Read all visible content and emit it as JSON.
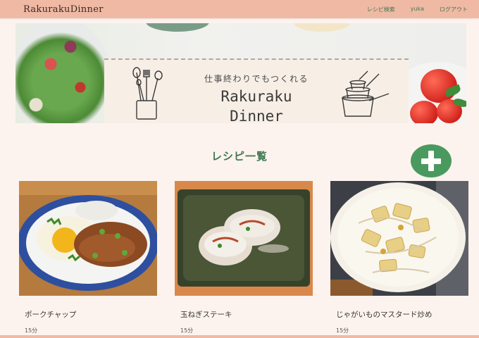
{
  "navbar": {
    "brand": "RakurakuDinner",
    "links": [
      "レシピ検索",
      "yuka",
      "ログアウト"
    ]
  },
  "hero": {
    "subtitle": "仕事終わりでもつくれる",
    "title": "Rakuraku\nDinner"
  },
  "section": {
    "title": "レシピ一覧"
  },
  "recipes": [
    {
      "name": "ポークチャップ",
      "time": "15分"
    },
    {
      "name": "玉ねぎステーキ",
      "time": "15分"
    },
    {
      "name": "じゃがいものマスタード炒め",
      "time": "15分"
    }
  ],
  "colors": {
    "navbar": "#f0b9a4",
    "background": "#fdf3ee",
    "accent_green": "#3e7a53",
    "add_button": "#4a9a5f"
  },
  "icons": {
    "add": "plus-icon",
    "hero_left": "kitchen-utensils-icon",
    "hero_right": "pots-icon"
  }
}
